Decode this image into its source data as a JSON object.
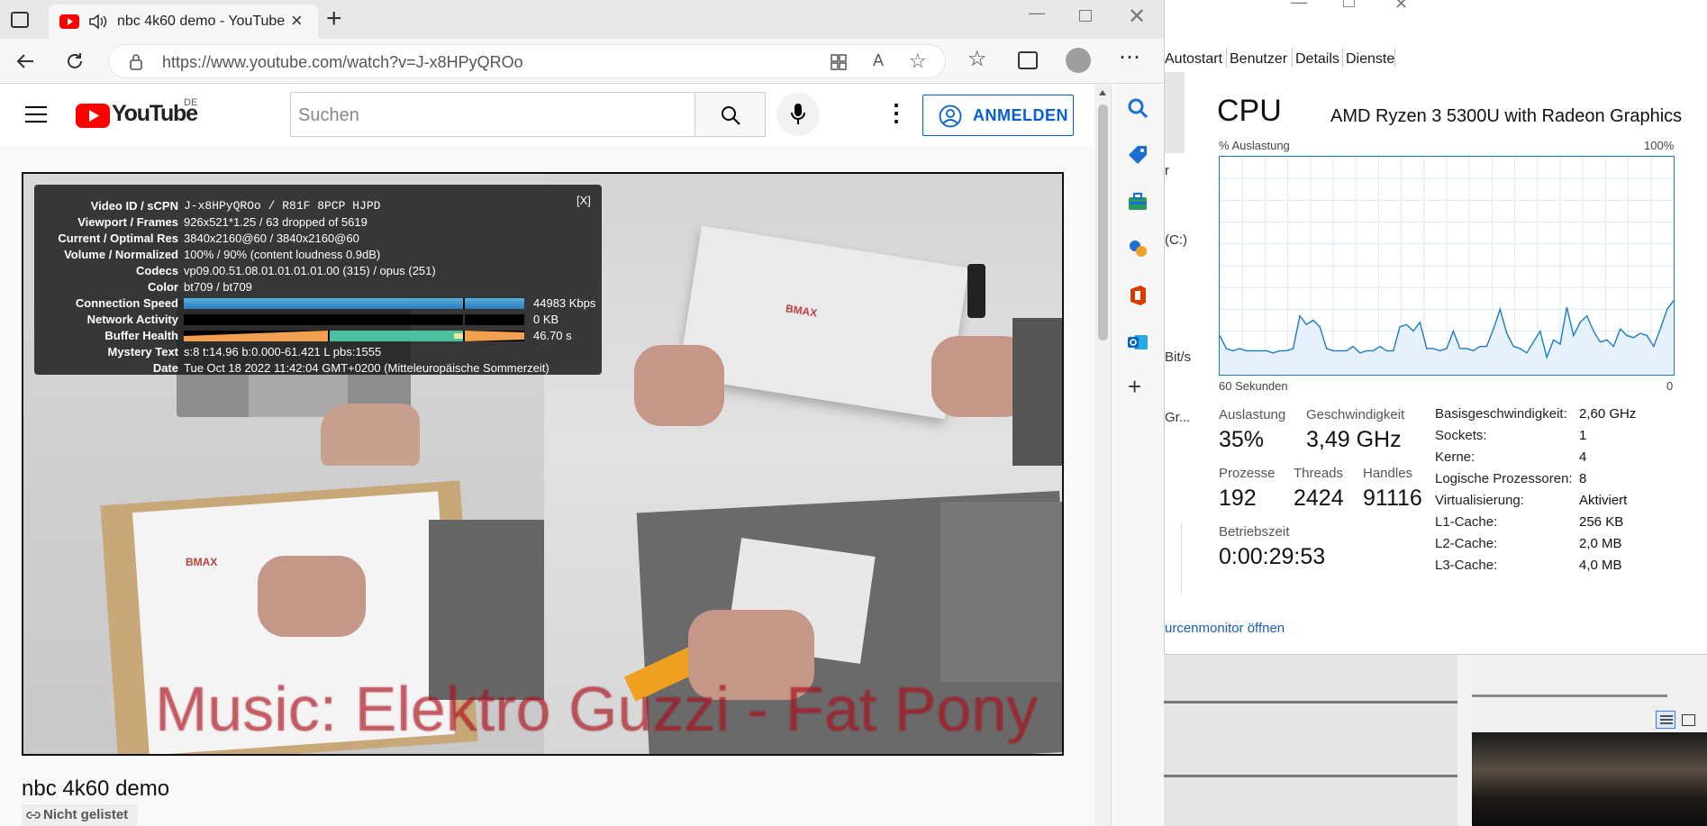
{
  "browser": {
    "tab_title": "nbc 4k60 demo - YouTube",
    "url": "https://www.youtube.com/watch?v=J-x8HPyQROo",
    "new_tab": "+",
    "tab_close": "×"
  },
  "youtube": {
    "logo_text": "YouTube",
    "region": "DE",
    "search_placeholder": "Suchen",
    "signin_label": "ANMELDEN",
    "video_title": "nbc 4k60 demo",
    "visibility_label": "Nicht gelistet"
  },
  "stats": {
    "close_label": "[X]",
    "rows": [
      {
        "label": "Video ID / sCPN",
        "value": "J-x8HPyQROo / R81F 8PCP HJPD"
      },
      {
        "label": "Viewport / Frames",
        "value": "926x521*1.25 / 63 dropped of 5619"
      },
      {
        "label": "Current / Optimal Res",
        "value": "3840x2160@60 / 3840x2160@60"
      },
      {
        "label": "Volume / Normalized",
        "value": "100% / 90% (content loudness 0.9dB)"
      },
      {
        "label": "Codecs",
        "value": "vp09.00.51.08.01.01.01.01.00 (315) / opus (251)"
      },
      {
        "label": "Color",
        "value": "bt709 / bt709"
      },
      {
        "label": "Connection Speed",
        "value": "44983 Kbps"
      },
      {
        "label": "Network Activity",
        "value": "0 KB"
      },
      {
        "label": "Buffer Health",
        "value": "46.70 s"
      },
      {
        "label": "Mystery Text",
        "value": "s:8 t:14.96 b:0.000-61.421 L pbs:1555"
      },
      {
        "label": "Date",
        "value": "Tue Oct 18 2022 11:42:04 GMT+0200 (Mitteleuropäische Sommerzeit)"
      }
    ]
  },
  "video_overlay": {
    "caption": "Music: Elektro Guzzi - Fat Pony",
    "brand_mark": "BMAX"
  },
  "taskmgr": {
    "tabs": [
      "Autostart",
      "Benutzer",
      "Details",
      "Dienste"
    ],
    "title": "CPU",
    "processor": "AMD Ryzen 3 5300U with Radeon Graphics",
    "util_label": "% Auslastung",
    "util_max": "100%",
    "time_left": "60 Sekunden",
    "time_right": "0",
    "left_fragments": [
      "r",
      "(C:)",
      "Bit/s",
      "Gr..."
    ],
    "stats": {
      "auslastung_label": "Auslastung",
      "auslastung": "35%",
      "geschwindigkeit_label": "Geschwindigkeit",
      "geschwindigkeit": "3,49 GHz",
      "prozesse_label": "Prozesse",
      "prozesse": "192",
      "threads_label": "Threads",
      "threads": "2424",
      "handles_label": "Handles",
      "handles": "91116",
      "betriebszeit_label": "Betriebszeit",
      "betriebszeit": "0:00:29:53"
    },
    "details": [
      {
        "label": "Basisgeschwindigkeit:",
        "value": "2,60 GHz"
      },
      {
        "label": "Sockets:",
        "value": "1"
      },
      {
        "label": "Kerne:",
        "value": "4"
      },
      {
        "label": "Logische Prozessoren:",
        "value": "8"
      },
      {
        "label": "Virtualisierung:",
        "value": "Aktiviert"
      },
      {
        "label": "L1-Cache:",
        "value": "256 KB"
      },
      {
        "label": "L2-Cache:",
        "value": "2,0 MB"
      },
      {
        "label": "L3-Cache:",
        "value": "4,0 MB"
      }
    ],
    "link": "urcenmonitor öffnen"
  },
  "chart_data": {
    "type": "line",
    "title": "CPU",
    "ylabel": "% Auslastung",
    "xlabel": "60 Sekunden",
    "ylim": [
      0,
      100
    ],
    "x": [
      0,
      1,
      2,
      3,
      4,
      5,
      6,
      7,
      8,
      9,
      10,
      11,
      12,
      13,
      14,
      15,
      16,
      17,
      18,
      19,
      20,
      21,
      22,
      23,
      24,
      25,
      26,
      27,
      28,
      29,
      30,
      31,
      32,
      33,
      34,
      35,
      36,
      37,
      38,
      39,
      40,
      41,
      42,
      43,
      44,
      45,
      46,
      47,
      48,
      49,
      50,
      51,
      52,
      53,
      54,
      55,
      56,
      57,
      58,
      59,
      60
    ],
    "series": [
      {
        "values": [
          18,
          12,
          11,
          12,
          11,
          11,
          11,
          11,
          10,
          11,
          11,
          12,
          27,
          23,
          25,
          22,
          12,
          11,
          11,
          11,
          13,
          10,
          11,
          11,
          13,
          11,
          11,
          22,
          23,
          20,
          24,
          12,
          12,
          11,
          12,
          20,
          12,
          12,
          11,
          13,
          13,
          21,
          30,
          19,
          13,
          12,
          10,
          15,
          20,
          8,
          16,
          14,
          31,
          18,
          24,
          27,
          20,
          15,
          16,
          13,
          21,
          18,
          17,
          19,
          18,
          13,
          21,
          30,
          34
        ]
      }
    ],
    "grid": true
  }
}
